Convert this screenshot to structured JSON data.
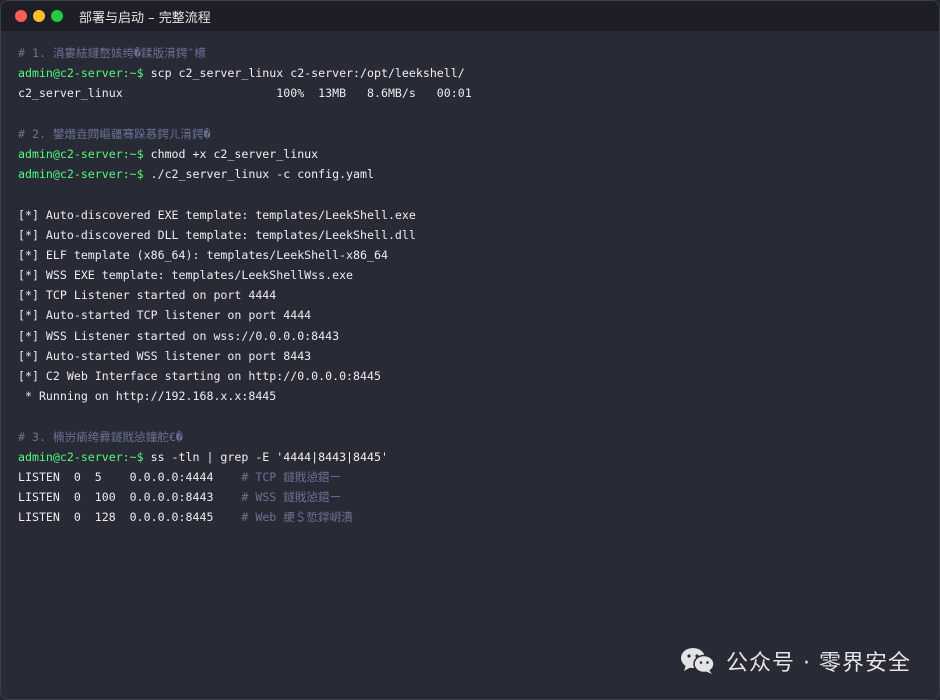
{
  "window": {
    "title": "部署与启动 – 完整流程",
    "traffic_lights": [
      "#ff5f57",
      "#febc2e",
      "#28c840"
    ]
  },
  "terminal": {
    "colors": {
      "comment": "#6b7394",
      "prompt": "#50fa7b",
      "text": "#ececee"
    },
    "lines": [
      {
        "type": "comment",
        "text": "# 1. 涓婁紶鏈嶅姟绔�鍒版湇鍔″櫒"
      },
      {
        "type": "command",
        "prompt": "admin@c2-server:~$",
        "cmd": " scp c2_server_linux c2-server:/opt/leekshell/"
      },
      {
        "type": "output",
        "text": "c2_server_linux                      100%  13MB   8.6MB/s   00:01"
      },
      {
        "type": "blank",
        "text": ""
      },
      {
        "type": "comment",
        "text": "# 2. 鐢熸垚閰嶇疆骞跺惎鍔ㄦ湇鍔�"
      },
      {
        "type": "command",
        "prompt": "admin@c2-server:~$",
        "cmd": " chmod +x c2_server_linux"
      },
      {
        "type": "command",
        "prompt": "admin@c2-server:~$",
        "cmd": " ./c2_server_linux -c config.yaml"
      },
      {
        "type": "blank",
        "text": ""
      },
      {
        "type": "output",
        "text": "[*] Auto-discovered EXE template: templates/LeekShell.exe"
      },
      {
        "type": "output",
        "text": "[*] Auto-discovered DLL template: templates/LeekShell.dll"
      },
      {
        "type": "output",
        "text": "[*] ELF template (x86_64): templates/LeekShell-x86_64"
      },
      {
        "type": "output",
        "text": "[*] WSS EXE template: templates/LeekShellWss.exe"
      },
      {
        "type": "output",
        "text": "[*] TCP Listener started on port 4444"
      },
      {
        "type": "output",
        "text": "[*] Auto-started TCP listener on port 4444"
      },
      {
        "type": "output",
        "text": "[*] WSS Listener started on wss://0.0.0.0:8443"
      },
      {
        "type": "output",
        "text": "[*] Auto-started WSS listener on port 8443"
      },
      {
        "type": "output",
        "text": "[*] C2 Web Interface starting on http://0.0.0.0:8445"
      },
      {
        "type": "output",
        "text": " * Running on http://192.168.x.x:8445"
      },
      {
        "type": "blank",
        "text": ""
      },
      {
        "type": "comment",
        "text": "# 3. 楠岃瘉绔彛鐩戝惉鐘舵€�"
      },
      {
        "type": "command",
        "prompt": "admin@c2-server:~$",
        "cmd": " ss -tln | grep -E '4444|8443|8445'"
      },
      {
        "type": "listen",
        "text": "LISTEN  0  5    0.0.0.0:4444    ",
        "comment": "# TCP 鐩戝惉鍣ㄧ"
      },
      {
        "type": "listen",
        "text": "LISTEN  0  100  0.0.0.0:8443    ",
        "comment": "# WSS 鐩戝惉鍣ㄧ"
      },
      {
        "type": "listen",
        "text": "LISTEN  0  128  0.0.0.0:8445    ",
        "comment": "# Web 绠＄悊鐣岄潰"
      }
    ]
  },
  "watermark": {
    "text": "公众号 · 零界安全",
    "icon": "wechat-icon"
  }
}
